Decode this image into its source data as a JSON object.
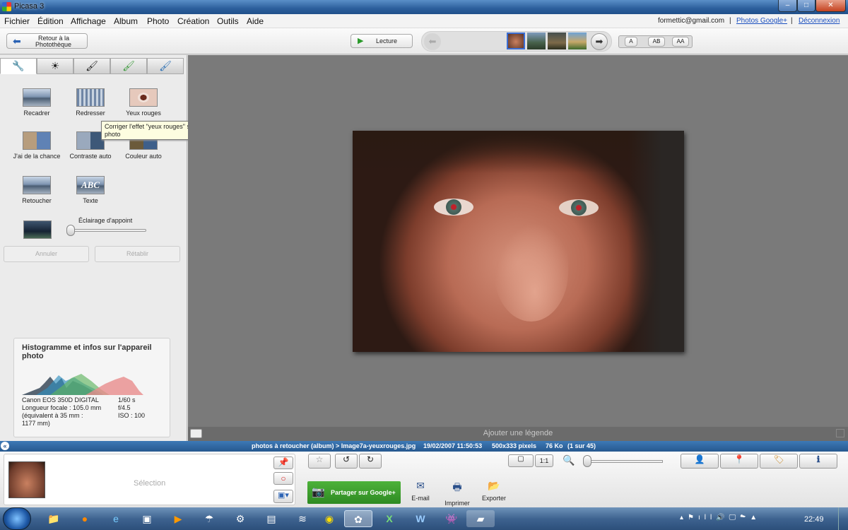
{
  "window": {
    "title": "Picasa 3",
    "minimize": "–",
    "maximize": "□",
    "close": "✕"
  },
  "menu": [
    "Fichier",
    "Édition",
    "Affichage",
    "Album",
    "Photo",
    "Création",
    "Outils",
    "Aide"
  ],
  "account": {
    "email": "formettic@gmail.com",
    "photos_link": "Photos Google+",
    "logout": "Déconnexion",
    "sep": "|"
  },
  "toolbar": {
    "back_line1": "Retour à la",
    "back_line2": "Photothèque",
    "play": "Lecture",
    "caption_buttons": [
      "A",
      "AB",
      "AA"
    ]
  },
  "tools": {
    "recadrer": "Recadrer",
    "redresser": "Redresser",
    "yeux_rouges": "Yeux rouges",
    "chance": "J'ai de la chance",
    "contraste": "Contraste auto",
    "couleur": "Couleur auto",
    "retoucher": "Retoucher",
    "texte": "Texte",
    "texte_thumb": "ABC",
    "eclairage": "Éclairage d'appoint",
    "annuler": "Annuler",
    "retablir": "Rétablir"
  },
  "tooltip": {
    "line1": "Corriger l'effet \"yeux rouges\" sur cette",
    "line2": "photo"
  },
  "histogram": {
    "title": "Histogramme et infos sur l'appareil photo",
    "camera": "Canon EOS 350D DIGITAL",
    "focal": "Longueur focale : 105.0 mm",
    "equiv1": "(équivalent à 35 mm :",
    "equiv2": "1177 mm)",
    "shutter": "1/60 s",
    "aperture": "f/4.5",
    "iso": "ISO : 100"
  },
  "caption_placeholder": "Ajouter une légende",
  "status": {
    "path": "photos à retoucher (album) > Image7a-yeuxrouges.jpg",
    "date": "19/02/2007 11:50:53",
    "size": "500x333 pixels",
    "weight": "76 Ko",
    "index": "(1 sur 45)"
  },
  "tray": {
    "selection": "Sélection",
    "share": "Partager sur Google+",
    "email": "E-mail",
    "print": "Imprimer",
    "export": "Exporter",
    "ratio": "1:1"
  },
  "taskbar": {
    "time": "22:49"
  },
  "colors": {
    "titlebar": "#2c5f9c",
    "statusbar": "#26588f",
    "share_green": "#3a9a2a",
    "center_bg": "#7a7a7a"
  }
}
